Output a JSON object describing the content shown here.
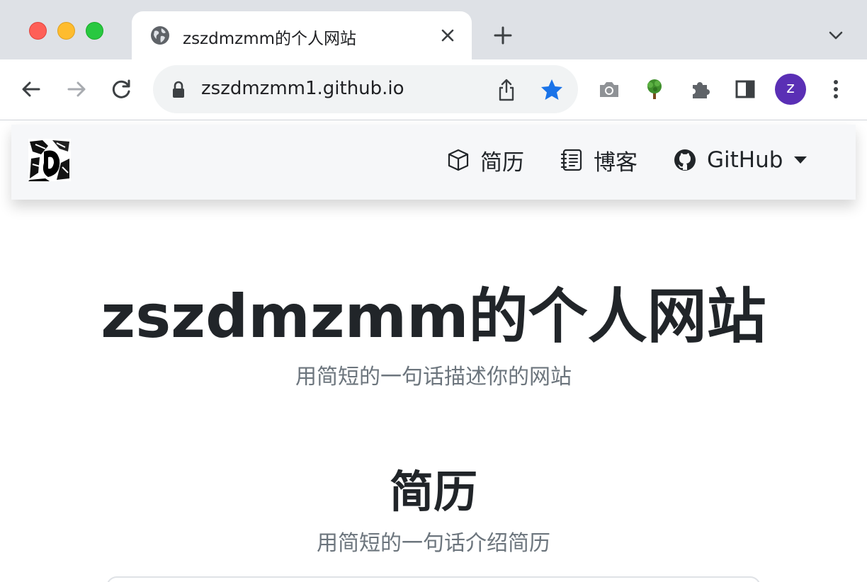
{
  "browser": {
    "tab": {
      "title": "zszdmzmm的个人网站",
      "favicon": "globe-icon"
    },
    "omnibox": {
      "url": "zszdmzmm1.github.io"
    },
    "profile": {
      "initial": "z",
      "color": "#5a2fb5"
    },
    "star_color": "#1a73e8"
  },
  "navbar": {
    "items": [
      {
        "label": "简历",
        "icon": "box-icon"
      },
      {
        "label": "博客",
        "icon": "journal-icon"
      },
      {
        "label": "GitHub",
        "icon": "github-icon"
      }
    ]
  },
  "hero": {
    "title": "zszdmzmm的个人网站",
    "subtitle": "用简短的一句话描述你的网站"
  },
  "resume_section": {
    "title": "简历",
    "subtitle": "用简短的一句话介绍简历"
  }
}
